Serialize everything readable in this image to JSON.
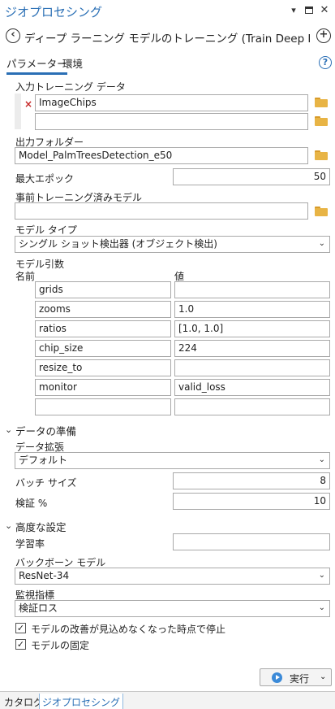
{
  "pane": {
    "title": "ジオプロセシング",
    "icons": {
      "menu": "chevron-down-icon",
      "maximize": "maximize-icon",
      "close": "close-icon"
    }
  },
  "tool": {
    "title": "ディープ ラーニング モデルのトレーニング (Train Deep Learni…",
    "back_icon": "back-arrow-icon",
    "add_icon": "add-icon"
  },
  "tabs": {
    "parameters": "パラメーター",
    "environments": "環境",
    "help_icon": "?"
  },
  "params": {
    "input_label": "入力トレーニング データ",
    "input_values": [
      "ImageChips",
      ""
    ],
    "remove_mark": "×",
    "output_label": "出力フォルダー",
    "output_value": "Model_PalmTreesDetection_e50",
    "max_epochs_label": "最大エポック",
    "max_epochs_value": "50",
    "pretrained_label": "事前トレーニング済みモデル",
    "pretrained_value": "",
    "model_type_label": "モデル タイプ",
    "model_type_value": "シングル ショット検出器 (オブジェクト検出)",
    "model_args_label": "モデル引数",
    "col_name": "名前",
    "col_value": "値",
    "model_args": [
      {
        "name": "grids",
        "value": ""
      },
      {
        "name": "zooms",
        "value": "1.0"
      },
      {
        "name": "ratios",
        "value": "[1.0, 1.0]"
      },
      {
        "name": "chip_size",
        "value": "224"
      },
      {
        "name": "resize_to",
        "value": ""
      },
      {
        "name": "monitor",
        "value": "valid_loss"
      },
      {
        "name": "",
        "value": ""
      }
    ]
  },
  "data_prep": {
    "section_label": "データの準備",
    "augmentation_label": "データ拡張",
    "augmentation_value": "デフォルト",
    "batch_size_label": "バッチ サイズ",
    "batch_size_value": "8",
    "validation_label": "検証 %",
    "validation_value": "10"
  },
  "advanced": {
    "section_label": "高度な設定",
    "learning_rate_label": "学習率",
    "learning_rate_value": "",
    "backbone_label": "バックボーン モデル",
    "backbone_value": "ResNet-34",
    "monitor_label": "監視指標",
    "monitor_value": "検証ロス",
    "stop_label": "モデルの改善が見込めなくなった時点で停止",
    "stop_checked": true,
    "freeze_label": "モデルの固定",
    "freeze_checked": true,
    "check_mark": "✓"
  },
  "run_button": {
    "label": "実行",
    "icon": "run-icon"
  },
  "bottom_tabs": [
    "カタログ",
    "ジオプロセシング"
  ],
  "colors": {
    "accent": "#2a6fb5",
    "folder": "#e8b445",
    "remove": "#c62828"
  }
}
